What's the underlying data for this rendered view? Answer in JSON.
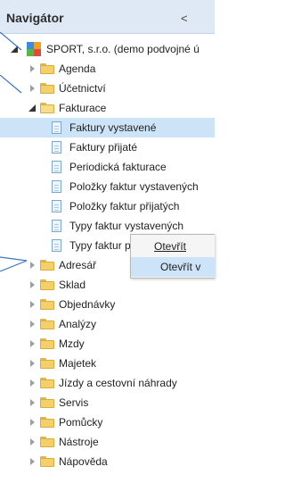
{
  "navigator": {
    "title": "Navigátor",
    "collapse_glyph": "<"
  },
  "tree": [
    {
      "label": "SPORT, s.r.o. (demo podvojné ú",
      "kind": "root",
      "state": "expanded"
    },
    {
      "label": "Agenda",
      "kind": "folder",
      "state": "collapsed"
    },
    {
      "label": "Účetnictví",
      "kind": "folder",
      "state": "collapsed"
    },
    {
      "label": "Fakturace",
      "kind": "folder",
      "state": "expanded"
    },
    {
      "label": "Faktury vystavené",
      "kind": "doc",
      "selected": true
    },
    {
      "label": "Faktury přijaté",
      "kind": "doc"
    },
    {
      "label": "Periodická fakturace",
      "kind": "doc"
    },
    {
      "label": "Položky faktur vystavených",
      "kind": "doc"
    },
    {
      "label": "Položky faktur přijatých",
      "kind": "doc"
    },
    {
      "label": "Typy faktur vystavených",
      "kind": "doc"
    },
    {
      "label": "Typy faktur přijatých",
      "kind": "doc"
    },
    {
      "label": "Adresář",
      "kind": "folder",
      "state": "collapsed"
    },
    {
      "label": "Sklad",
      "kind": "folder",
      "state": "collapsed"
    },
    {
      "label": "Objednávky",
      "kind": "folder",
      "state": "collapsed"
    },
    {
      "label": "Analýzy",
      "kind": "folder",
      "state": "collapsed"
    },
    {
      "label": "Mzdy",
      "kind": "folder",
      "state": "collapsed"
    },
    {
      "label": "Majetek",
      "kind": "folder",
      "state": "collapsed"
    },
    {
      "label": "Jízdy a cestovní náhrady",
      "kind": "folder",
      "state": "collapsed"
    },
    {
      "label": "Servis",
      "kind": "folder",
      "state": "collapsed"
    },
    {
      "label": "Pomůcky",
      "kind": "folder",
      "state": "collapsed"
    },
    {
      "label": "Nástroje",
      "kind": "folder",
      "state": "collapsed"
    },
    {
      "label": "Nápověda",
      "kind": "folder",
      "state": "collapsed"
    }
  ],
  "context_menu": {
    "items": [
      {
        "label": "Otevřít"
      },
      {
        "label": "Otevřít v",
        "highlighted": true
      }
    ]
  }
}
